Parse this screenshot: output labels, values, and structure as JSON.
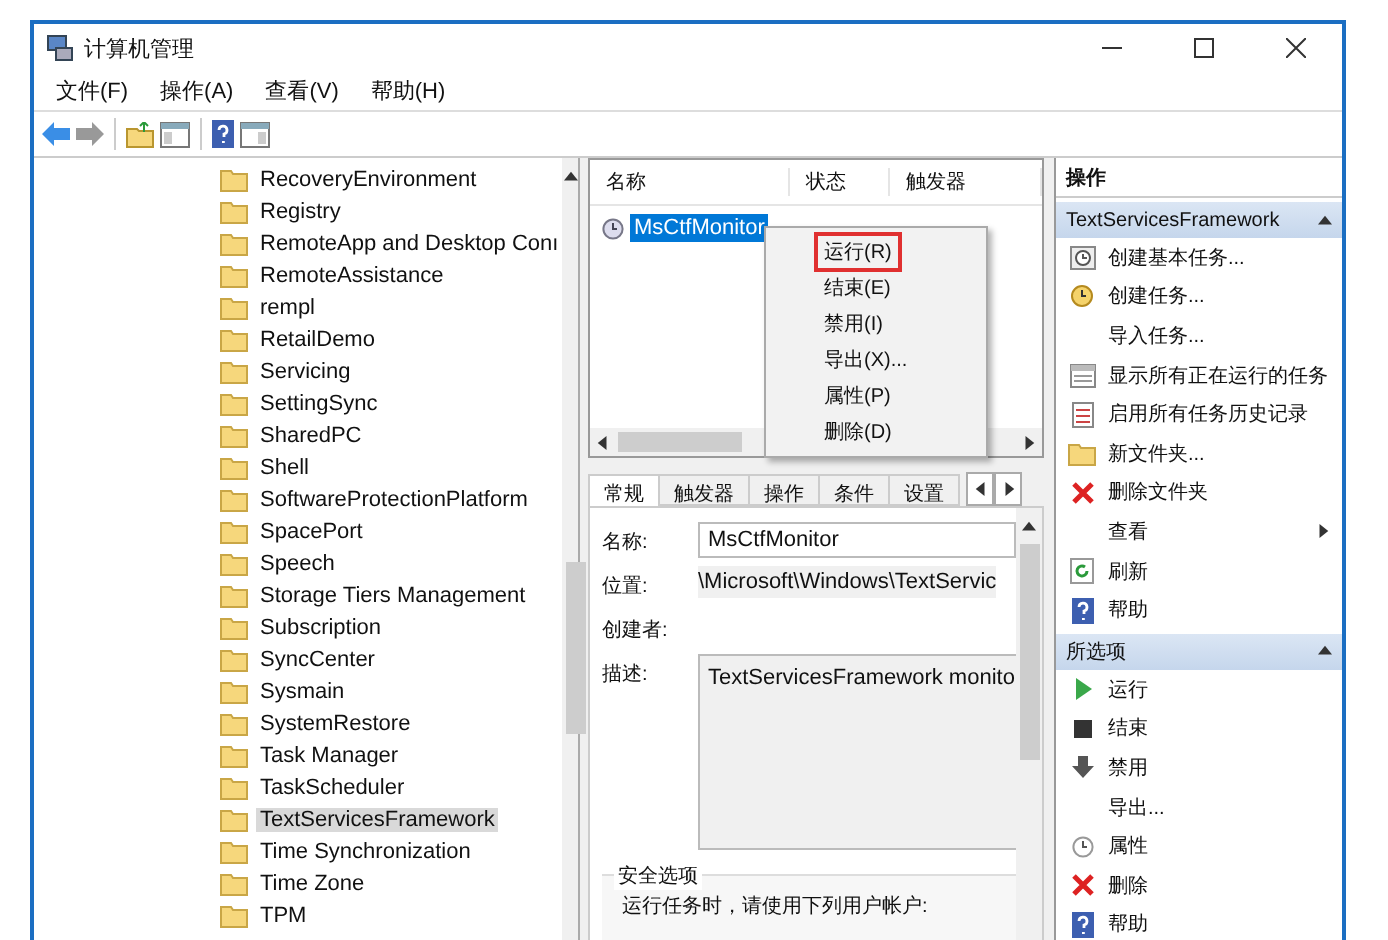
{
  "window": {
    "title": "计算机管理"
  },
  "menu": [
    {
      "label": "文件(F)"
    },
    {
      "label": "操作(A)"
    },
    {
      "label": "查看(V)"
    },
    {
      "label": "帮助(H)"
    }
  ],
  "tree": {
    "items": [
      {
        "label": "RecoveryEnvironment",
        "selected": false
      },
      {
        "label": "Registry",
        "selected": false
      },
      {
        "label": "RemoteApp and Desktop Conı",
        "selected": false
      },
      {
        "label": "RemoteAssistance",
        "selected": false
      },
      {
        "label": "rempl",
        "selected": false
      },
      {
        "label": "RetailDemo",
        "selected": false
      },
      {
        "label": "Servicing",
        "selected": false
      },
      {
        "label": "SettingSync",
        "selected": false
      },
      {
        "label": "SharedPC",
        "selected": false
      },
      {
        "label": "Shell",
        "selected": false
      },
      {
        "label": "SoftwareProtectionPlatform",
        "selected": false
      },
      {
        "label": "SpacePort",
        "selected": false
      },
      {
        "label": "Speech",
        "selected": false
      },
      {
        "label": "Storage Tiers Management",
        "selected": false
      },
      {
        "label": "Subscription",
        "selected": false
      },
      {
        "label": "SyncCenter",
        "selected": false
      },
      {
        "label": "Sysmain",
        "selected": false
      },
      {
        "label": "SystemRestore",
        "selected": false
      },
      {
        "label": "Task Manager",
        "selected": false
      },
      {
        "label": "TaskScheduler",
        "selected": false
      },
      {
        "label": "TextServicesFramework",
        "selected": true
      },
      {
        "label": "Time Synchronization",
        "selected": false
      },
      {
        "label": "Time Zone",
        "selected": false
      },
      {
        "label": "TPM",
        "selected": false
      }
    ]
  },
  "task_list": {
    "columns": [
      "名称",
      "状态",
      "触发器"
    ],
    "rows": [
      {
        "name": "MsCtfMonitor",
        "selected": true
      }
    ]
  },
  "context_menu": {
    "items": [
      {
        "label": "运行(R)",
        "selected": true
      },
      {
        "label": "结束(E)",
        "selected": false
      },
      {
        "label": "禁用(I)",
        "selected": false
      },
      {
        "label": "导出(X)...",
        "selected": false
      },
      {
        "label": "属性(P)",
        "selected": false
      },
      {
        "label": "删除(D)",
        "selected": false
      }
    ]
  },
  "details": {
    "tabs": [
      {
        "label": "常规",
        "selected": true
      },
      {
        "label": "触发器",
        "selected": false
      },
      {
        "label": "操作",
        "selected": false
      },
      {
        "label": "条件",
        "selected": false
      },
      {
        "label": "设置",
        "selected": false
      }
    ],
    "fields": [
      {
        "kind": "input",
        "label": "名称:",
        "value": "MsCtfMonitor"
      },
      {
        "kind": "text",
        "label": "位置:",
        "value": "\\Microsoft\\Windows\\TextServic"
      },
      {
        "kind": "text",
        "label": "创建者:"
      },
      {
        "kind": "textarea",
        "label": "描述:",
        "value": "TextServicesFramework monito"
      }
    ],
    "security": {
      "title": "安全选项",
      "text": "运行任务时，请使用下列用户帐户:"
    }
  },
  "actions": {
    "header": "操作",
    "sections": [
      {
        "title": "TextServicesFramework",
        "items": [
          {
            "kind": "basic-task",
            "label": "创建基本任务...",
            "submenu": false
          },
          {
            "kind": "task",
            "label": "创建任务...",
            "submenu": false
          },
          {
            "kind": "none",
            "label": "导入任务...",
            "submenu": false
          },
          {
            "kind": "list",
            "label": "显示所有正在运行的任务",
            "submenu": false
          },
          {
            "kind": "history",
            "label": "启用所有任务历史记录",
            "submenu": false
          },
          {
            "kind": "folder",
            "label": "新文件夹...",
            "submenu": false
          },
          {
            "kind": "delete",
            "label": "删除文件夹",
            "submenu": false
          },
          {
            "kind": "none",
            "label": "查看",
            "submenu": true
          },
          {
            "kind": "refresh",
            "label": "刷新",
            "submenu": false
          },
          {
            "kind": "help",
            "label": "帮助",
            "submenu": false
          }
        ]
      },
      {
        "title": "所选项",
        "items": [
          {
            "kind": "run",
            "label": "运行",
            "submenu": false
          },
          {
            "kind": "stop",
            "label": "结束",
            "submenu": false
          },
          {
            "kind": "disable",
            "label": "禁用",
            "submenu": false
          },
          {
            "kind": "none",
            "label": "导出...",
            "submenu": false
          },
          {
            "kind": "clock",
            "label": "属性",
            "submenu": false
          },
          {
            "kind": "delete",
            "label": "删除",
            "submenu": false
          },
          {
            "kind": "help",
            "label": "帮助",
            "submenu": false
          }
        ]
      }
    ]
  }
}
